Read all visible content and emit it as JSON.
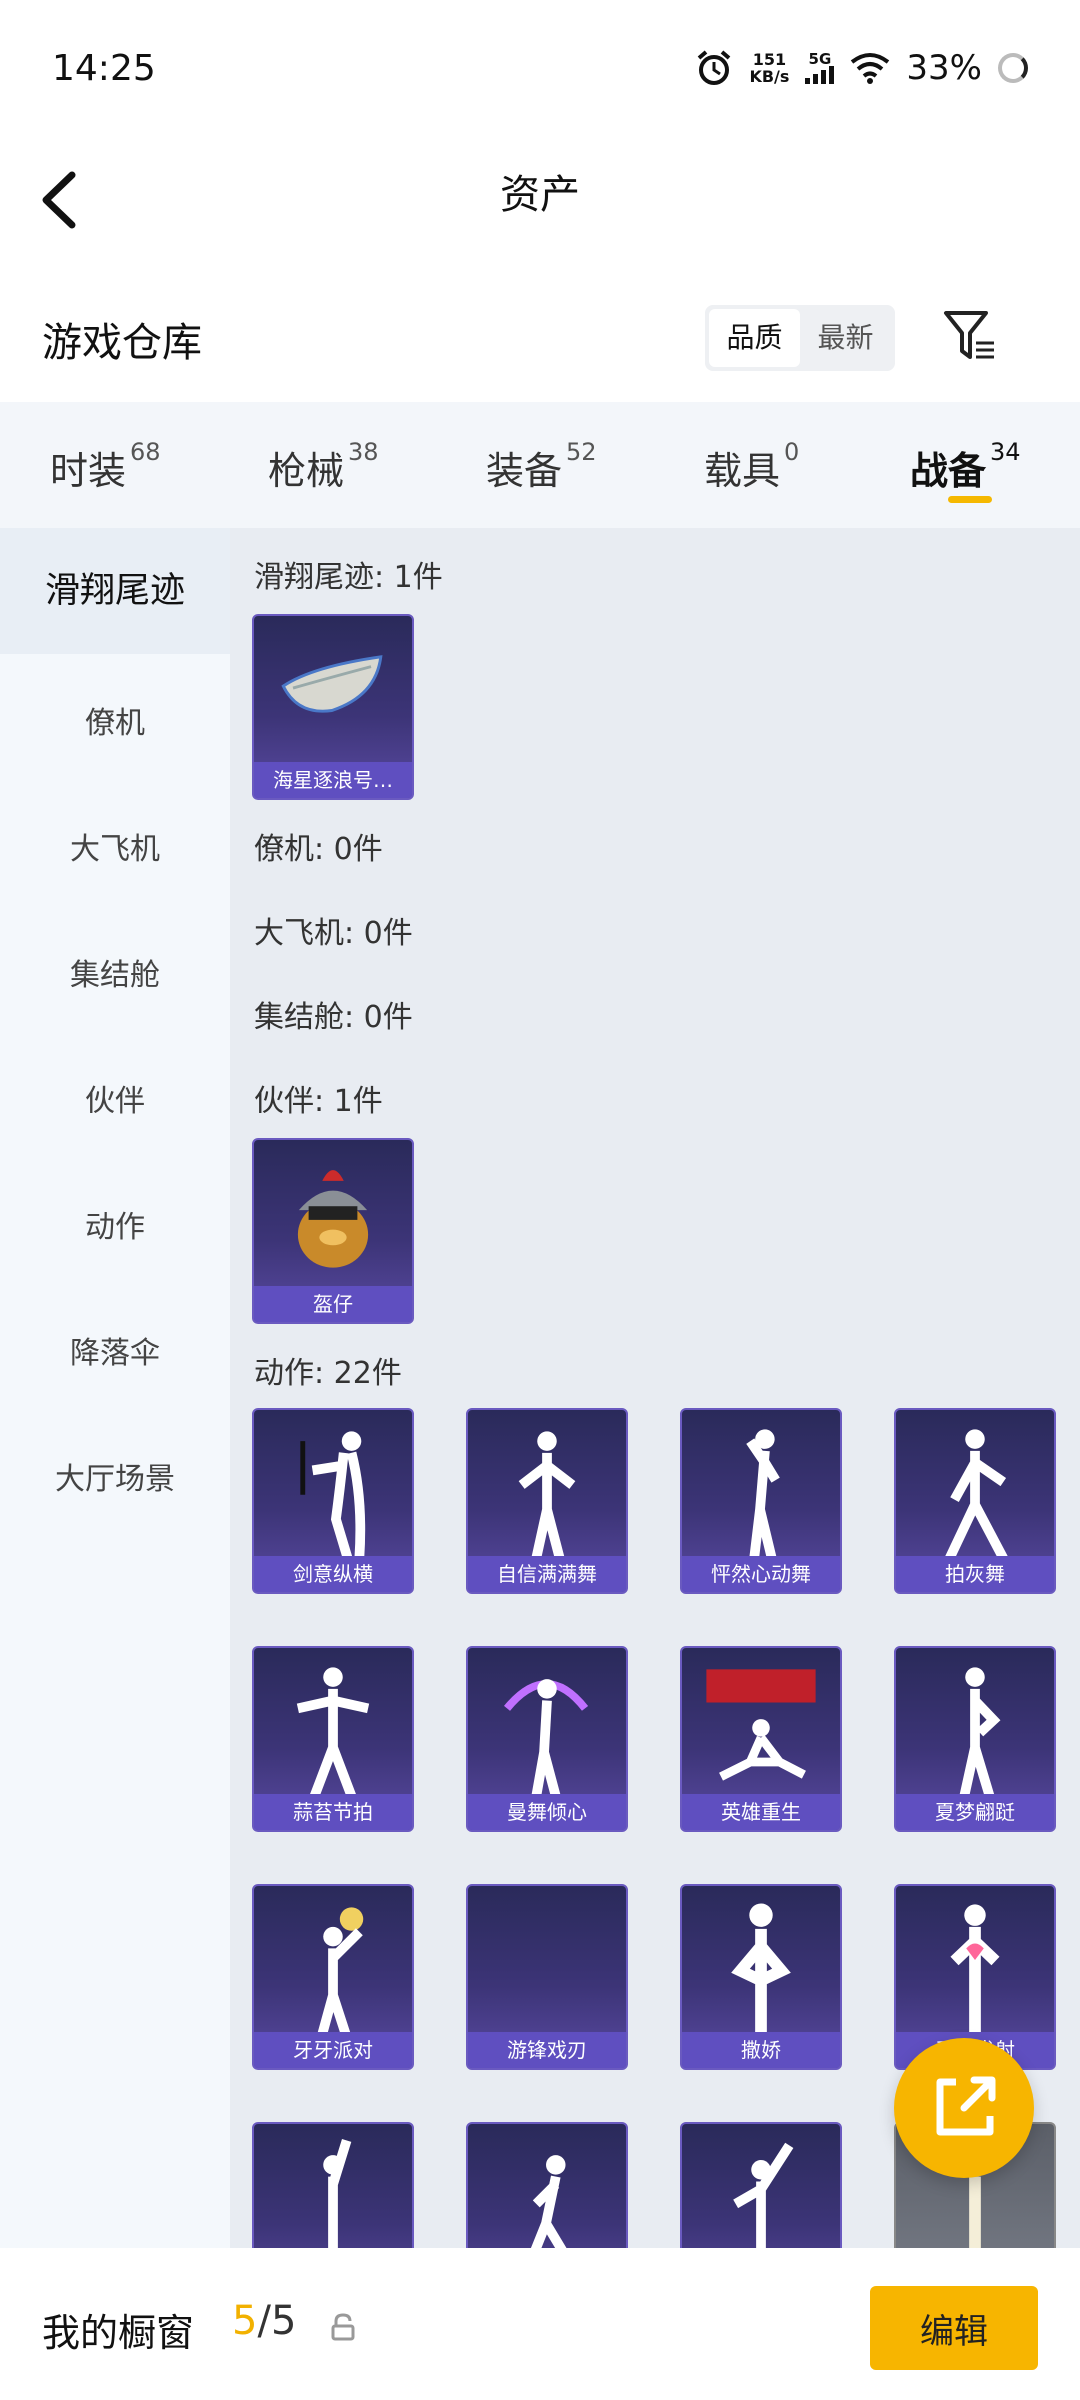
{
  "status_bar": {
    "time": "14:25",
    "net_speed_value": "151",
    "net_speed_unit": "KB/s",
    "network": "5G",
    "battery": "33%"
  },
  "header": {
    "title": "资产"
  },
  "warehouse": {
    "title": "游戏仓库",
    "sort_options": [
      "品质",
      "最新"
    ],
    "sort_selected": "品质"
  },
  "tabs": [
    {
      "label": "时装",
      "count": "68"
    },
    {
      "label": "枪械",
      "count": "38"
    },
    {
      "label": "装备",
      "count": "52"
    },
    {
      "label": "载具",
      "count": "0"
    },
    {
      "label": "战备",
      "count": "34"
    }
  ],
  "active_tab": "战备",
  "side_nav": [
    "滑翔尾迹",
    "僚机",
    "大飞机",
    "集结舱",
    "伙伴",
    "动作",
    "降落伞",
    "大厅场景"
  ],
  "sections": {
    "glide": {
      "label": "滑翔尾迹: 1件",
      "items": [
        "海星逐浪号…"
      ]
    },
    "wingman": {
      "label": "僚机: 0件"
    },
    "plane": {
      "label": "大飞机: 0件"
    },
    "capsule": {
      "label": "集结舱: 0件"
    },
    "partner": {
      "label": "伙伴: 1件",
      "items": [
        "盔仔"
      ]
    },
    "emote": {
      "label": "动作: 22件",
      "items": [
        "剑意纵横",
        "自信满满舞",
        "怦然心动舞",
        "拍灰舞",
        "蒜苔节拍",
        "曼舞倾心",
        "英雄重生",
        "夏梦翩跹",
        "牙牙派对",
        "游锋戏刃",
        "撒娇",
        "爱心发射"
      ]
    }
  },
  "bottom_bar": {
    "label": "我的橱窗",
    "current": "5",
    "total": "5",
    "edit_label": "编辑"
  },
  "colors": {
    "accent": "#f7b500",
    "card_bg": "#3c3477",
    "card_caption": "#5f4fc0"
  }
}
